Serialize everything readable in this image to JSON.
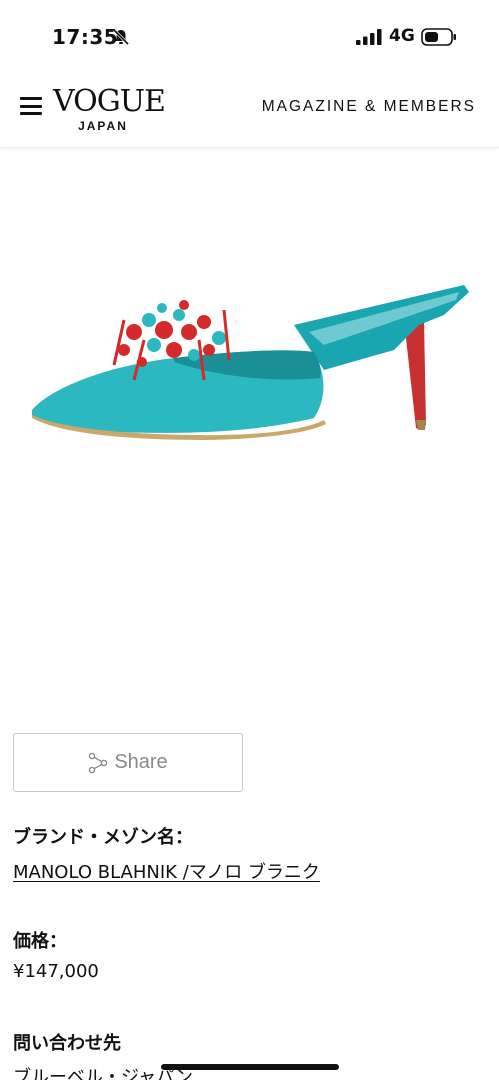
{
  "status_bar": {
    "time": "17:35",
    "network": "4G",
    "icons": [
      "bell-slash-icon",
      "cellular-signal-icon",
      "battery-icon"
    ]
  },
  "header": {
    "logo_main": "VOGUE",
    "logo_sub": "JAPAN",
    "menu_icon": "hamburger-menu-icon",
    "nav_link": "MAGAZINE & MEMBERS"
  },
  "product": {
    "image": "turquoise-embellished-mule-image"
  },
  "share": {
    "label": "Share",
    "icon": "share-icon"
  },
  "details": {
    "brand_label": "ブランド・メゾン名：",
    "brand_value": "MANOLO BLAHNIK /マノロ ブラニク",
    "price_label": "価格：",
    "price_value": "¥147,000",
    "contact_label": "問い合わせ先",
    "contact_value": "ブルーベル・ジャパン"
  },
  "colors": {
    "shoe": "#2cb8c0",
    "beads": "#d42a2a",
    "heel": "#c93030",
    "border": "#c9c9c9"
  }
}
